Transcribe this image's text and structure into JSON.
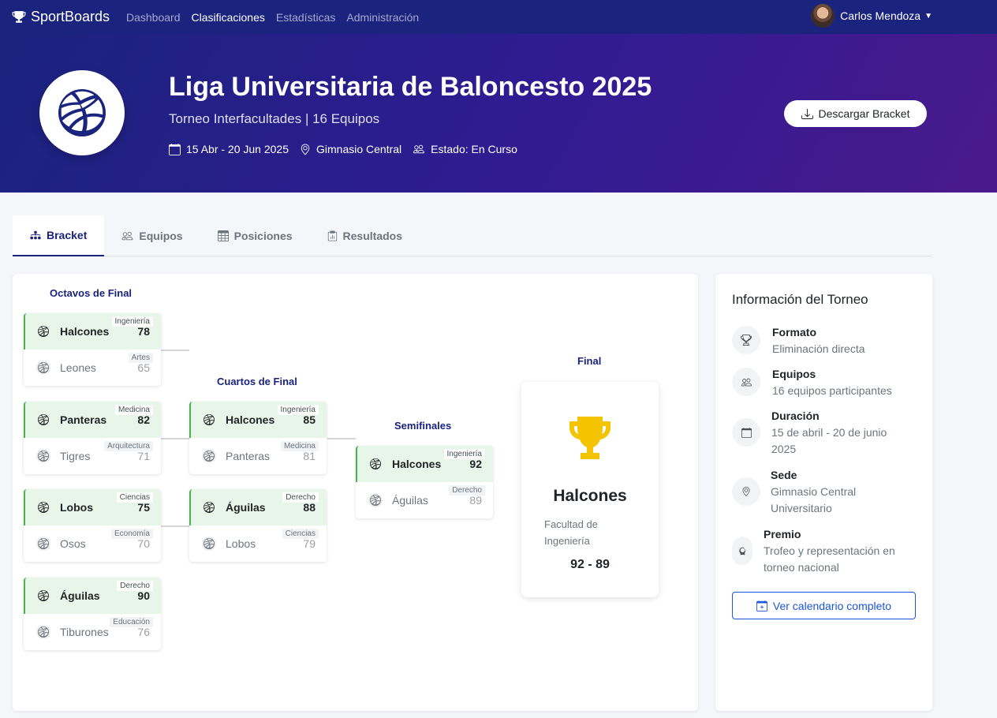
{
  "navbar": {
    "brand": "SportBoards",
    "links": [
      "Dashboard",
      "Clasificaciones",
      "Estadísticas",
      "Administración"
    ],
    "active_link": "Clasificaciones",
    "user_name": "Carlos Mendoza"
  },
  "hero": {
    "title": "Liga Universitaria de Baloncesto 2025",
    "subtitle": "Torneo Interfacultades | 16 Equipos",
    "dates": "15 Abr - 20 Jun 2025",
    "venue": "Gimnasio Central",
    "status": "Estado: En Curso",
    "download_label": "Descargar Bracket"
  },
  "tabs": [
    "Bracket",
    "Equipos",
    "Posiciones",
    "Resultados"
  ],
  "bracket": {
    "rounds": {
      "octavos": "Octavos de Final",
      "cuartos": "Cuartos de Final",
      "semis": "Semifinales",
      "final": "Final"
    },
    "octavos": [
      {
        "winner": {
          "team": "Halcones",
          "faculty": "Ingeniería",
          "score": "78"
        },
        "loser": {
          "team": "Leones",
          "faculty": "Artes",
          "score": "65"
        }
      },
      {
        "winner": {
          "team": "Panteras",
          "faculty": "Medicina",
          "score": "82"
        },
        "loser": {
          "team": "Tigres",
          "faculty": "Arquitectura",
          "score": "71"
        }
      },
      {
        "winner": {
          "team": "Lobos",
          "faculty": "Ciencias",
          "score": "75"
        },
        "loser": {
          "team": "Osos",
          "faculty": "Economía",
          "score": "70"
        }
      },
      {
        "winner": {
          "team": "Águilas",
          "faculty": "Derecho",
          "score": "90"
        },
        "loser": {
          "team": "Tiburones",
          "faculty": "Educación",
          "score": "76"
        }
      }
    ],
    "cuartos": [
      {
        "winner": {
          "team": "Halcones",
          "faculty": "Ingeniería",
          "score": "85"
        },
        "loser": {
          "team": "Panteras",
          "faculty": "Medicina",
          "score": "81"
        }
      },
      {
        "winner": {
          "team": "Águilas",
          "faculty": "Derecho",
          "score": "88"
        },
        "loser": {
          "team": "Lobos",
          "faculty": "Ciencias",
          "score": "79"
        }
      }
    ],
    "semis": [
      {
        "winner": {
          "team": "Halcones",
          "faculty": "Ingeniería",
          "score": "92"
        },
        "loser": {
          "team": "Águilas",
          "faculty": "Derecho",
          "score": "89"
        }
      }
    ],
    "champion": {
      "team": "Halcones",
      "faculty": "Facultad de Ingeniería",
      "score": "92 - 89"
    }
  },
  "info": {
    "title": "Información del Torneo",
    "items": [
      {
        "label": "Formato",
        "value": "Eliminación directa",
        "icon": "trophy-icon"
      },
      {
        "label": "Equipos",
        "value": "16 equipos participantes",
        "icon": "people-icon"
      },
      {
        "label": "Duración",
        "value": "15 de abril - 20 de junio 2025",
        "icon": "calendar-icon"
      },
      {
        "label": "Sede",
        "value": "Gimnasio Central Universitario",
        "icon": "location-icon"
      },
      {
        "label": "Premio",
        "value": "Trofeo y representación en torneo nacional",
        "icon": "award-icon"
      }
    ],
    "calendar_button": "Ver calendario completo"
  },
  "colors": {
    "navbar": "#1a237e",
    "accent": "#1a237e",
    "winner_bg": "#e8f5e9",
    "winner_border": "#4caf50",
    "trophy": "#f5c400",
    "link_blue": "#1a56db"
  }
}
